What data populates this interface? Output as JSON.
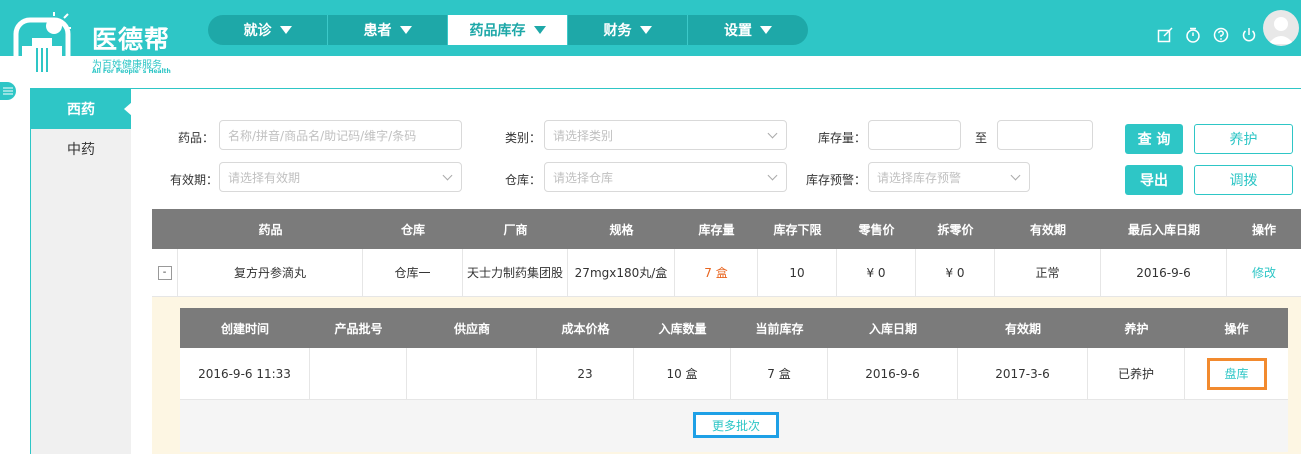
{
  "brand": {
    "name": "医德帮",
    "tagline": "为百姓健康服务",
    "tagline_en": "All For People' s Health",
    "accent": "#2ec6c6"
  },
  "nav": {
    "items": [
      {
        "label": "就诊",
        "active": false
      },
      {
        "label": "患者",
        "active": false
      },
      {
        "label": "药品库存",
        "active": true
      },
      {
        "label": "财务",
        "active": false
      },
      {
        "label": "设置",
        "active": false
      }
    ]
  },
  "header_icons": [
    "edit-icon",
    "timer-icon",
    "help-icon",
    "power-icon"
  ],
  "sidebar": {
    "items": [
      {
        "label": "西药",
        "active": true
      },
      {
        "label": "中药",
        "active": false
      }
    ]
  },
  "filters": {
    "drug_label": "药品：",
    "drug_placeholder": "名称/拼音/商品名/助记码/维字/条码",
    "category_label": "类别：",
    "category_placeholder": "请选择类别",
    "stock_label": "库存量：",
    "stock_to": "至",
    "expiry_label": "有效期：",
    "expiry_placeholder": "请选择有效期",
    "warehouse_label": "仓库：",
    "warehouse_placeholder": "请选择仓库",
    "warning_label": "库存预警：",
    "warning_placeholder": "请选择库存预警"
  },
  "buttons": {
    "query": "查 询",
    "maintain": "养护",
    "export": "导出",
    "transfer": "调拨"
  },
  "table": {
    "headers": [
      "药品",
      "仓库",
      "厂商",
      "规格",
      "库存量",
      "库存下限",
      "零售价",
      "拆零价",
      "有效期",
      "最后入库日期",
      "操作"
    ],
    "rows": [
      {
        "expand": "-",
        "drug": "复方丹参滴丸",
        "warehouse": "仓库一",
        "maker": "天士力制药集团股",
        "spec": "27mgx180丸/盒",
        "stock": "7 盒",
        "min_stock": "10",
        "retail": "¥ 0",
        "split_price": "¥ 0",
        "validity": "正常",
        "last_in": "2016-9-6",
        "action": "修改"
      }
    ]
  },
  "sub_table": {
    "headers": [
      "创建时间",
      "产品批号",
      "供应商",
      "成本价格",
      "入库数量",
      "当前库存",
      "入库日期",
      "有效期",
      "养护",
      "操作"
    ],
    "rows": [
      {
        "created": "2016-9-6 11:33",
        "batch": "",
        "supplier": "",
        "cost": "23",
        "in_qty": "10 盒",
        "current": "7 盒",
        "in_date": "2016-9-6",
        "expiry": "2017-3-6",
        "maintain": "已养护",
        "action": "盘库"
      }
    ],
    "more": "更多批次"
  }
}
